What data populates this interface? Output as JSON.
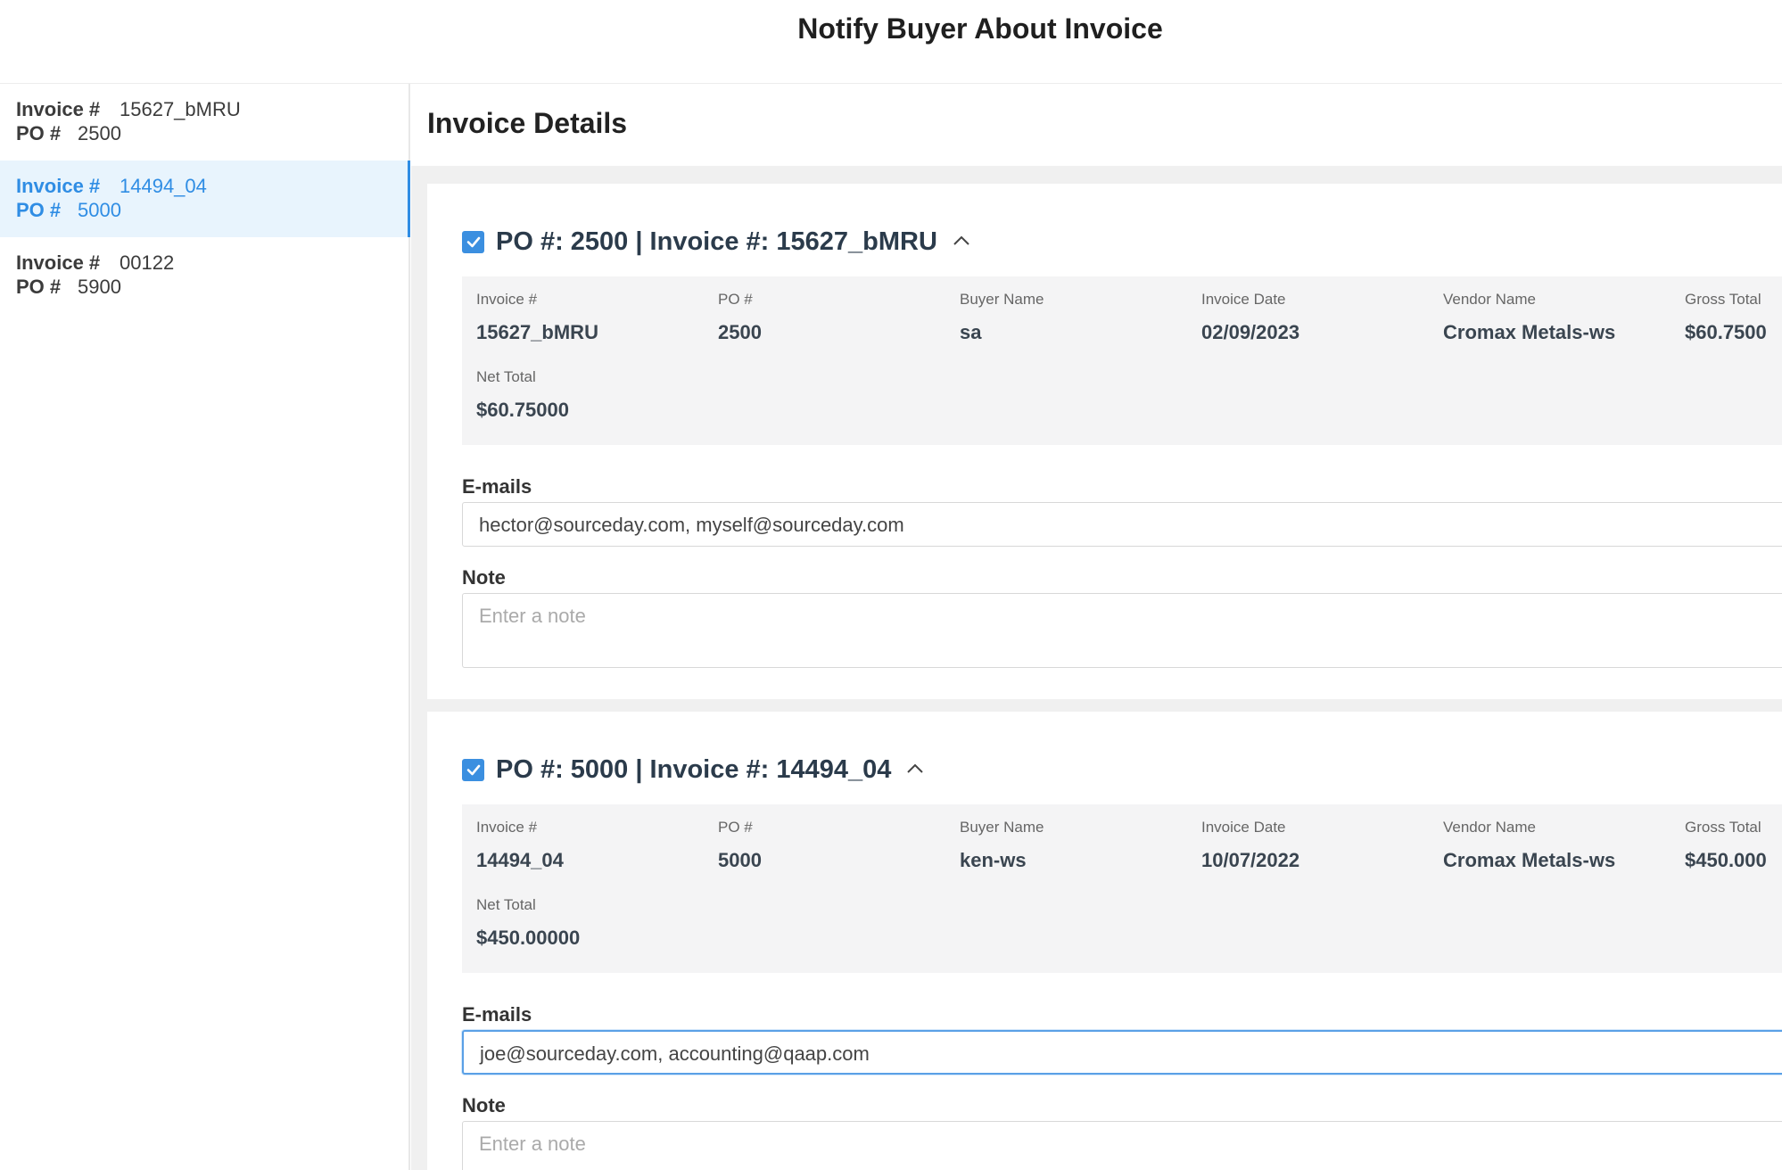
{
  "header": {
    "title": "Notify Buyer About Invoice"
  },
  "sidebar": {
    "items": [
      {
        "invoice_label": "Invoice #",
        "invoice": "15627_bMRU",
        "po_label": "PO #",
        "po": "2500"
      },
      {
        "invoice_label": "Invoice #",
        "invoice": "14494_04",
        "po_label": "PO #",
        "po": "5000"
      },
      {
        "invoice_label": "Invoice #",
        "invoice": "00122",
        "po_label": "PO #",
        "po": "5900"
      }
    ]
  },
  "main": {
    "title": "Invoice Details",
    "field_labels": {
      "invoice": "Invoice #",
      "po": "PO #",
      "buyer": "Buyer Name",
      "date": "Invoice Date",
      "vendor": "Vendor Name",
      "gross": "Gross Total",
      "net": "Net Total",
      "emails": "E-mails",
      "note": "Note"
    },
    "note_placeholder": "Enter a note",
    "cards": [
      {
        "title": "PO #: 2500 | Invoice #: 15627_bMRU",
        "checked": true,
        "invoice": "15627_bMRU",
        "po": "2500",
        "buyer": "sa",
        "date": "02/09/2023",
        "vendor": "Cromax Metals-ws",
        "gross": "$60.7500",
        "net": "$60.75000",
        "emails": "hector@sourceday.com, myself@sourceday.com"
      },
      {
        "title": "PO #: 5000 | Invoice #: 14494_04",
        "checked": true,
        "invoice": "14494_04",
        "po": "5000",
        "buyer": "ken-ws",
        "date": "10/07/2022",
        "vendor": "Cromax Metals-ws",
        "gross": "$450.000",
        "net": "$450.00000",
        "emails": "joe@sourceday.com, accounting@qaap.com"
      }
    ]
  },
  "colors": {
    "accent": "#2f8de4",
    "checkbox": "#3b8fe0",
    "active_bg": "#e8f4fd"
  },
  "icons": {
    "checkbox": "checkmark-icon",
    "collapse": "chevron-up-icon"
  }
}
